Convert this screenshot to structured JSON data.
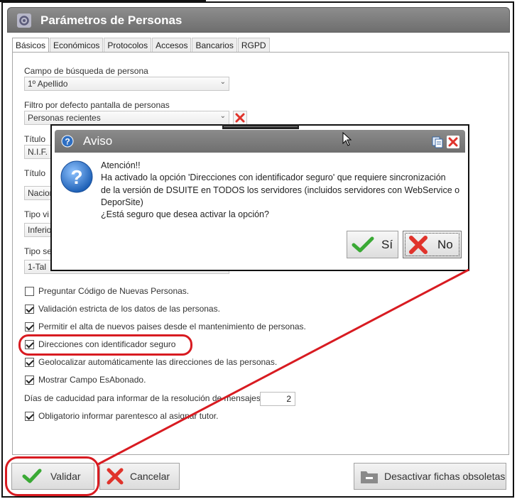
{
  "window": {
    "title": "Parámetros de Personas"
  },
  "tabs": [
    {
      "label": "Básicos",
      "active": true
    },
    {
      "label": "Económicos"
    },
    {
      "label": "Protocolos"
    },
    {
      "label": "Accesos"
    },
    {
      "label": "Bancarios"
    },
    {
      "label": "RGPD"
    }
  ],
  "fields": {
    "busqueda": {
      "label": "Campo de búsqueda de persona",
      "value": "1º Apellido"
    },
    "filtro": {
      "label": "Filtro por defecto pantalla de personas",
      "value": "Personas recientes"
    },
    "titulo1": {
      "label_visible": "Título",
      "value_visible": "N.I.F."
    },
    "titulo2": {
      "label_visible": "Título",
      "value_visible": "Nacion"
    },
    "tipo1": {
      "label_visible": "Tipo vi",
      "value_visible": "Inferio"
    },
    "tipo2": {
      "label_visible": "Tipo se",
      "value_visible": "1-Tal"
    }
  },
  "checkboxes": [
    {
      "label": "Preguntar Código de Nuevas Personas.",
      "checked": false
    },
    {
      "label": "Validación estricta de los datos de las personas.",
      "checked": true
    },
    {
      "label": "Permitir el alta de nuevos paises desde el mantenimiento de personas.",
      "checked": true
    },
    {
      "label": "Direcciones con identificador seguro",
      "checked": true
    },
    {
      "label": "Geolocalizar automáticamente las direcciones de las personas.",
      "checked": true
    },
    {
      "label": "Mostrar Campo EsAbonado.",
      "checked": true
    }
  ],
  "dias": {
    "label": "Días de caducidad para informar de la resolución de mensajes",
    "value": "2"
  },
  "tutor": {
    "label": "Obligatorio informar parentesco al asignar tutor.",
    "checked": true
  },
  "buttons": {
    "validar": "Validar",
    "cancelar": "Cancelar",
    "desactivar": "Desactivar fichas obsoletas"
  },
  "dialog": {
    "title": "Aviso",
    "lines": [
      "Atención!!",
      "Ha activado la opción 'Direcciones con identificador seguro' que requiere sincronización",
      "de la versión de DSUITE en TODOS los servidores (incluidos servidores con WebService o",
      "DeporSite)",
      "¿Está seguro que desea activar la opción?"
    ],
    "yes": "Sí",
    "no": "No"
  },
  "colors": {
    "annotation_red": "#d81b21",
    "title_gray": "#7a7a7a",
    "check_green": "#3aa935",
    "cross_red": "#e0332b"
  }
}
